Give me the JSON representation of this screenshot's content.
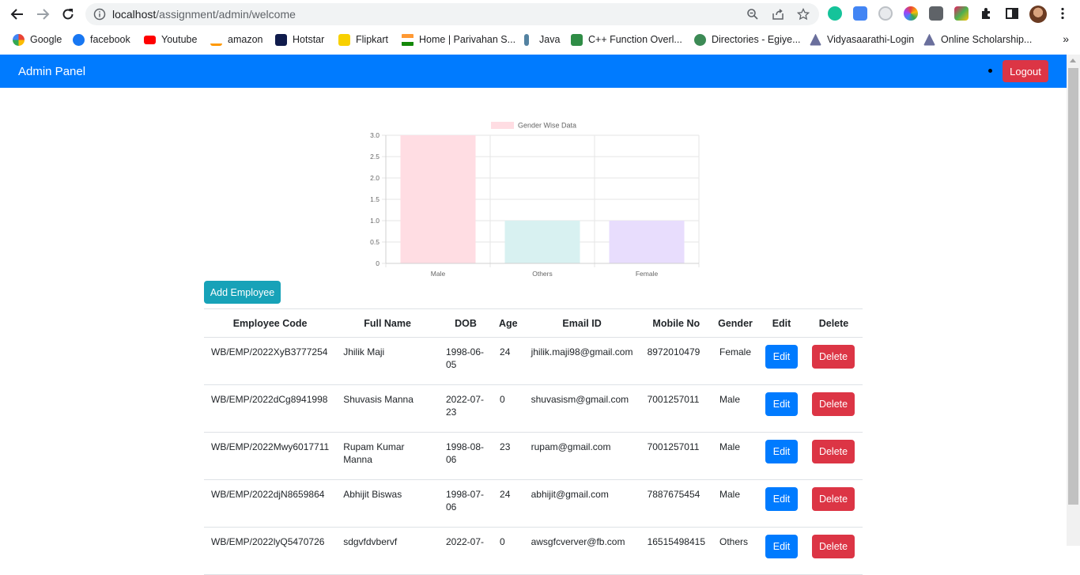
{
  "browser": {
    "url_host": "localhost",
    "url_path": "/assignment/admin/welcome",
    "bookmarks": [
      {
        "label": "Google",
        "icon": "google-icon",
        "color": "#4285f4"
      },
      {
        "label": "facebook",
        "icon": "facebook-icon",
        "color": "#1877f2"
      },
      {
        "label": "Youtube",
        "icon": "youtube-icon",
        "color": "#ff0000"
      },
      {
        "label": "amazon",
        "icon": "amazon-icon",
        "color": "#232f3e"
      },
      {
        "label": "Hotstar",
        "icon": "hotstar-icon",
        "color": "#0f1b4c"
      },
      {
        "label": "Flipkart",
        "icon": "flipkart-icon",
        "color": "#f8d000"
      },
      {
        "label": "Home | Parivahan S...",
        "icon": "india-flag-icon",
        "color": "#ff9933"
      },
      {
        "label": "Java",
        "icon": "java-icon",
        "color": "#5382a1"
      },
      {
        "label": "C++ Function Overl...",
        "icon": "w3-icon",
        "color": "#2f8d46"
      },
      {
        "label": "Directories - Egiye...",
        "icon": "emblem-icon",
        "color": "#3c8a55"
      },
      {
        "label": "Vidyasaarathi-Login",
        "icon": "vidyasaarathi-icon",
        "color": "#6a6f9c"
      },
      {
        "label": "Online Scholarship...",
        "icon": "scholarship-icon",
        "color": "#6a6f9c"
      }
    ]
  },
  "app": {
    "brand": "Admin Panel",
    "logout_label": "Logout",
    "navbar_color": "#007bff",
    "add_employee_label": "Add Employee"
  },
  "chart_data": {
    "type": "bar",
    "categories": [
      "Male",
      "Others",
      "Female"
    ],
    "series": [
      {
        "name": "Gender Wise Data",
        "values": [
          3,
          1,
          1
        ]
      }
    ],
    "colors": [
      "#ffdde3",
      "#d8f1f1",
      "#e8ddfd"
    ],
    "ylim": [
      0,
      3.0
    ],
    "yticks": [
      "0",
      "0.5",
      "1.0",
      "1.5",
      "2.0",
      "2.5",
      "3.0"
    ],
    "legend": "top"
  },
  "table": {
    "headers": [
      "Employee Code",
      "Full Name",
      "DOB",
      "Age",
      "Email ID",
      "Mobile No",
      "Gender",
      "Edit",
      "Delete"
    ],
    "rows": [
      {
        "code": "WB/EMP/2022XyB3777254",
        "name": "Jhilik Maji",
        "dob": "1998-06-05",
        "age": "24",
        "email": "jhilik.maji98@gmail.com",
        "mobile": "8972010479",
        "gender": "Female",
        "edit": "Edit",
        "delete": "Delete"
      },
      {
        "code": "WB/EMP/2022dCg8941998",
        "name": "Shuvasis Manna",
        "dob": "2022-07-23",
        "age": "0",
        "email": "shuvasism@gmail.com",
        "mobile": "7001257011",
        "gender": "Male",
        "edit": "Edit",
        "delete": "Delete"
      },
      {
        "code": "WB/EMP/2022Mwy6017711",
        "name": "Rupam Kumar Manna",
        "dob": "1998-08-06",
        "age": "23",
        "email": "rupam@gmail.com",
        "mobile": "7001257011",
        "gender": "Male",
        "edit": "Edit",
        "delete": "Delete"
      },
      {
        "code": "WB/EMP/2022djN8659864",
        "name": "Abhijit Biswas",
        "dob": "1998-07-06",
        "age": "24",
        "email": "abhijit@gmail.com",
        "mobile": "7887675454",
        "gender": "Male",
        "edit": "Edit",
        "delete": "Delete"
      },
      {
        "code": "WB/EMP/2022lyQ5470726",
        "name": "sdgvfdvbervf",
        "dob": "2022-07-",
        "age": "0",
        "email": "awsgfcverver@fb.com",
        "mobile": "16515498415",
        "gender": "Others",
        "edit": "Edit",
        "delete": "Delete"
      }
    ]
  }
}
